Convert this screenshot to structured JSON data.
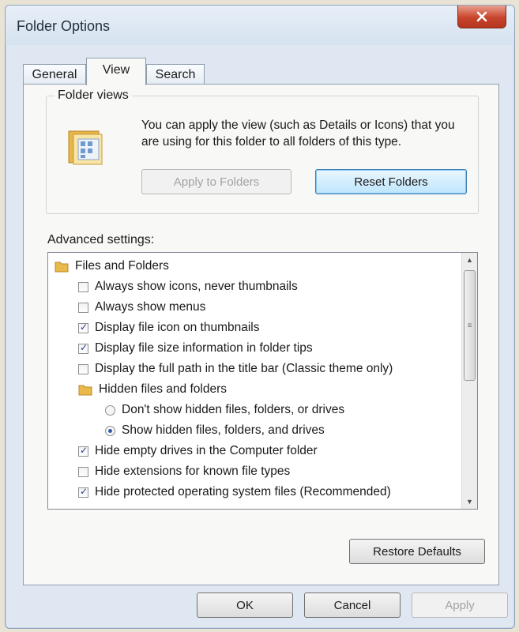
{
  "window": {
    "title": "Folder Options"
  },
  "tabs": [
    {
      "label": "General",
      "selected": false
    },
    {
      "label": "View",
      "selected": true
    },
    {
      "label": "Search",
      "selected": false
    }
  ],
  "folder_views": {
    "title": "Folder views",
    "description": "You can apply the view (such as Details or Icons) that you are using for this folder to all folders of this type.",
    "apply_button": "Apply to Folders",
    "reset_button": "Reset Folders",
    "icon": "folder-view-icon"
  },
  "advanced": {
    "label": "Advanced settings:",
    "items": [
      {
        "kind": "folder",
        "label": "Files and Folders"
      },
      {
        "kind": "checkbox",
        "label": "Always show icons, never thumbnails",
        "checked": false
      },
      {
        "kind": "checkbox",
        "label": "Always show menus",
        "checked": false
      },
      {
        "kind": "checkbox",
        "label": "Display file icon on thumbnails",
        "checked": true
      },
      {
        "kind": "checkbox",
        "label": "Display file size information in folder tips",
        "checked": true
      },
      {
        "kind": "checkbox",
        "label": "Display the full path in the title bar (Classic theme only)",
        "checked": false
      },
      {
        "kind": "folder",
        "label": "Hidden files and folders"
      },
      {
        "kind": "radio",
        "label": "Don't show hidden files, folders, or drives",
        "checked": false
      },
      {
        "kind": "radio",
        "label": "Show hidden files, folders, and drives",
        "checked": true
      },
      {
        "kind": "checkbox",
        "label": "Hide empty drives in the Computer folder",
        "checked": true
      },
      {
        "kind": "checkbox",
        "label": "Hide extensions for known file types",
        "checked": false
      },
      {
        "kind": "checkbox",
        "label": "Hide protected operating system files (Recommended)",
        "checked": true
      }
    ]
  },
  "buttons": {
    "restore_defaults": "Restore Defaults",
    "ok": "OK",
    "cancel": "Cancel",
    "apply": "Apply"
  },
  "colors": {
    "close_button": "#c7442b",
    "accent": "#3c7fb1"
  }
}
